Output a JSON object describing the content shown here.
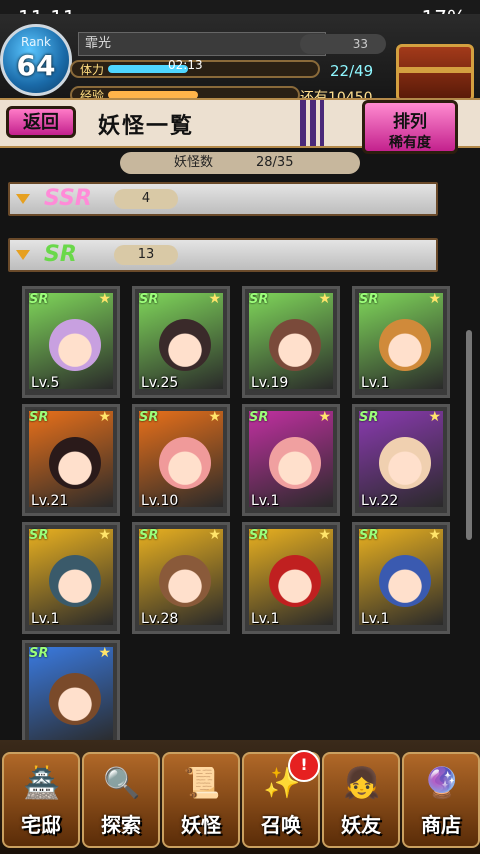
{
  "status": {
    "time": "11:11",
    "battery": "17%"
  },
  "header": {
    "rank_label": "Rank",
    "rank": "64",
    "player_name": "霏光",
    "stamina_label": "体力",
    "stamina_timer": "02:13",
    "stamina_value": "22/49",
    "exp_label": "经验",
    "exp_remaining": "还有10450",
    "gem_count": "33"
  },
  "nav": {
    "back": "返回",
    "title": "妖怪一覧",
    "sort_line1": "排列",
    "sort_line2": "稀有度"
  },
  "count": {
    "label": "妖怪数",
    "value": "28/35"
  },
  "groups": [
    {
      "rarity": "SSR",
      "count": "4"
    },
    {
      "rarity": "SR",
      "count": "13"
    }
  ],
  "cards": [
    {
      "badge": "SR",
      "lv": "Lv.5",
      "color": "#7fd65a",
      "face": "#c8a0e0"
    },
    {
      "badge": "SR",
      "lv": "Lv.25",
      "color": "#7fd65a",
      "face": "#3a2a2a"
    },
    {
      "badge": "SR",
      "lv": "Lv.19",
      "color": "#7fd65a",
      "face": "#7a4a3a"
    },
    {
      "badge": "SR",
      "lv": "Lv.1",
      "color": "#7fd65a",
      "face": "#d08a3a"
    },
    {
      "badge": "SR",
      "lv": "Lv.21",
      "color": "#e8701a",
      "face": "#2a1a1a"
    },
    {
      "badge": "SR",
      "lv": "Lv.10",
      "color": "#e8701a",
      "face": "#f09a9a"
    },
    {
      "badge": "SR",
      "lv": "Lv.1",
      "color": "#c030a0",
      "face": "#f0a0a0"
    },
    {
      "badge": "SR",
      "lv": "Lv.22",
      "color": "#8a3ab0",
      "face": "#f0d0b0"
    },
    {
      "badge": "SR",
      "lv": "Lv.1",
      "color": "#e8b020",
      "face": "#3a5a6a"
    },
    {
      "badge": "SR",
      "lv": "Lv.28",
      "color": "#e8b020",
      "face": "#8a5a3a"
    },
    {
      "badge": "SR",
      "lv": "Lv.1",
      "color": "#e8b020",
      "face": "#c02020"
    },
    {
      "badge": "SR",
      "lv": "Lv.1",
      "color": "#e8b020",
      "face": "#3a5ab0"
    },
    {
      "badge": "SR",
      "lv": "",
      "color": "#3a7ae0",
      "face": "#7a4a2a"
    }
  ],
  "footer": [
    {
      "label": "宅邸",
      "icon": "🏯",
      "name": "mansion"
    },
    {
      "label": "探索",
      "icon": "🔍",
      "name": "explore"
    },
    {
      "label": "妖怪",
      "icon": "📜",
      "name": "yokai"
    },
    {
      "label": "召唤",
      "icon": "✨",
      "name": "summon"
    },
    {
      "label": "妖友",
      "icon": "👧",
      "name": "friends"
    },
    {
      "label": "商店",
      "icon": "🔮",
      "name": "shop"
    }
  ],
  "summon_alert": "!"
}
